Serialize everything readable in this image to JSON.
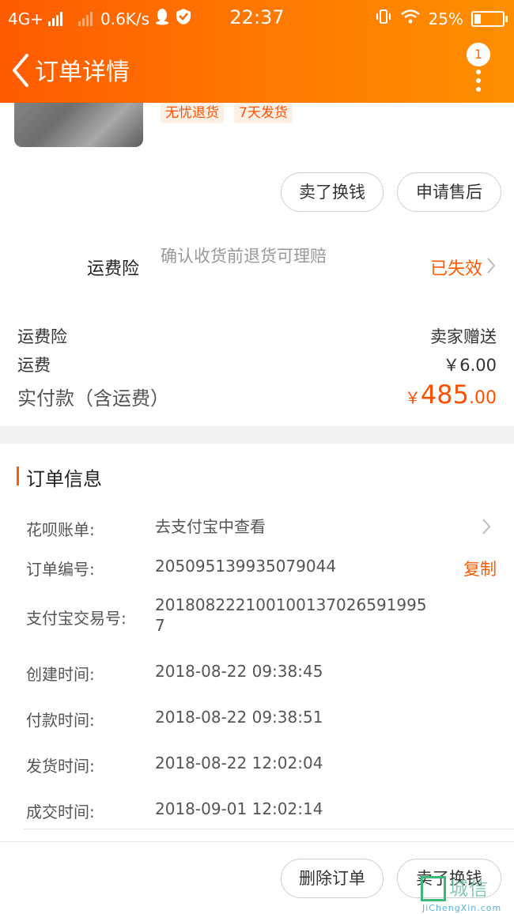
{
  "status_bar": {
    "network": "4G+",
    "speed": "0.6K/s",
    "time": "22:37",
    "battery": "25%"
  },
  "header": {
    "title": "订单详情",
    "badge_count": "1"
  },
  "product": {
    "tags": [
      "无忧退货",
      "7天发货"
    ]
  },
  "actions_top": {
    "sell_label": "卖了换钱",
    "aftersale_label": "申请售后"
  },
  "insurance": {
    "label": "运费险",
    "desc": "确认收货前退货可理赔",
    "status": "已失效"
  },
  "fees": {
    "insurance_label": "运费险",
    "insurance_value": "卖家赠送",
    "shipping_label": "运费",
    "shipping_value": "￥6.00",
    "total_label": "实付款（含运费）",
    "currency": "￥",
    "total_int": "485",
    "total_dec": ".00"
  },
  "order_info": {
    "title": "订单信息",
    "rows": [
      {
        "label": "花呗账单:",
        "value": "去支付宝中查看"
      },
      {
        "label": "订单编号:",
        "value": "205095139935079044"
      },
      {
        "label": "支付宝交易号:",
        "value": "2018082221001001370265919957"
      },
      {
        "label": "创建时间:",
        "value": "2018-08-22 09:38:45"
      },
      {
        "label": "付款时间:",
        "value": "2018-08-22 09:38:51"
      },
      {
        "label": "发货时间:",
        "value": "2018-08-22 12:02:04"
      },
      {
        "label": "成交时间:",
        "value": "2018-09-01 12:02:14"
      }
    ],
    "copy_label": "复制"
  },
  "actions_bottom": {
    "delete_label": "删除订单",
    "sell_label": "卖了换钱"
  },
  "watermark": {
    "text": "城信",
    "sub": "JiChengXin.com"
  },
  "colors": {
    "accent": "#ff5a00",
    "header_start": "#ff5b00",
    "header_end": "#ff8f00"
  }
}
